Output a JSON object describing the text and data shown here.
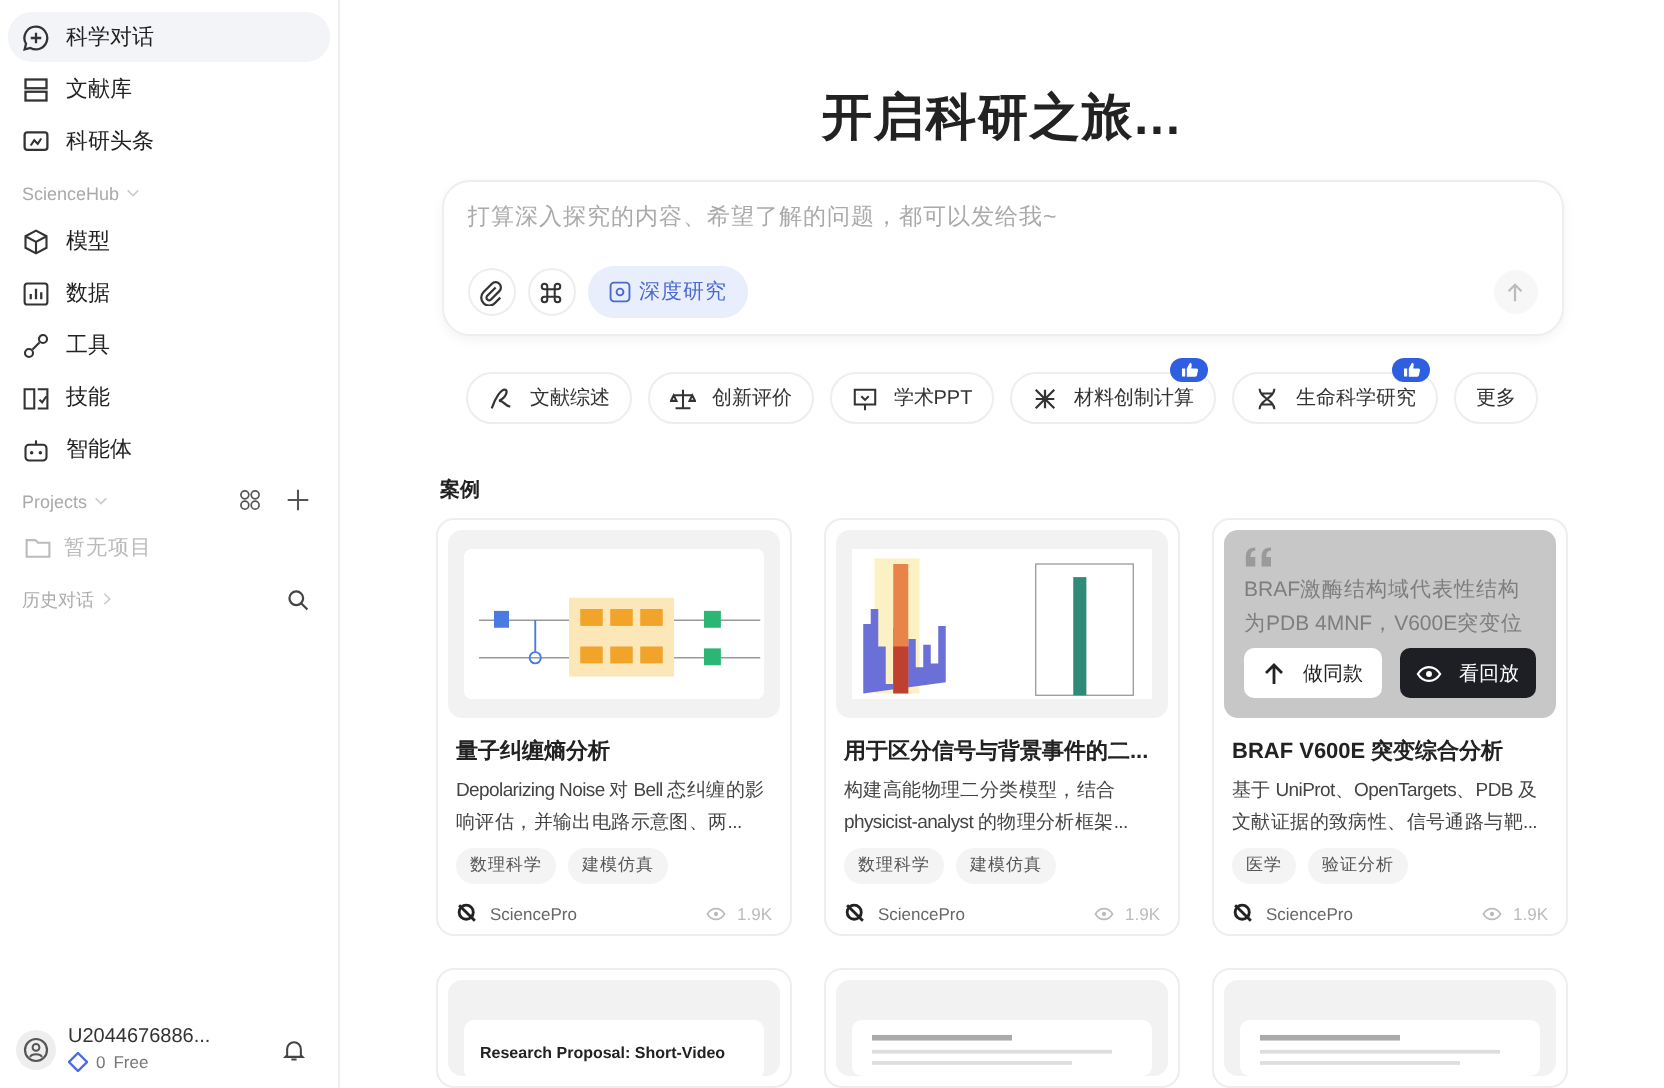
{
  "sidebar": {
    "main_items": [
      {
        "label": "科学对话",
        "selected": true
      },
      {
        "label": "文献库",
        "selected": false
      },
      {
        "label": "科研头条",
        "selected": false
      }
    ],
    "hub_section": {
      "label": "ScienceHub"
    },
    "hub_items": [
      {
        "label": "模型",
        "selected": false
      },
      {
        "label": "数据",
        "selected": false
      },
      {
        "label": "工具",
        "selected": false
      },
      {
        "label": "技能",
        "selected": false
      },
      {
        "label": "智能体",
        "selected": false
      }
    ],
    "projects": {
      "label": "Projects",
      "empty_text": "暂无项目"
    },
    "history": {
      "label": "历史对话"
    },
    "user": {
      "name": "U2044676886...",
      "points": "0",
      "plan": "Free"
    }
  },
  "main": {
    "title": "开启科研之旅...",
    "composer": {
      "placeholder": "打算深入探究的内容、希望了解的问题，都可以发给我~",
      "deep_research": {
        "label": "深度研究",
        "on": true
      }
    },
    "quick_actions": [
      {
        "label": "文献综述",
        "liked": false
      },
      {
        "label": "创新评价",
        "liked": false
      },
      {
        "label": "学术PPT",
        "liked": false
      },
      {
        "label": "材料创制计算",
        "liked": true
      },
      {
        "label": "生命科学研究",
        "liked": true
      },
      {
        "label": "更多",
        "liked": false
      }
    ],
    "cases_heading": "案例",
    "cases": [
      {
        "title": "量子纠缠熵分析",
        "description": "Depolarizing Noise 对 Bell 态纠缠的影响评估，并输出电路示意图、两...",
        "tags": [
          "数理科学",
          "建模仿真"
        ],
        "author": "SciencePro",
        "views": "1.9K"
      },
      {
        "title": "用于区分信号与背景事件的二...",
        "description": "构建高能物理二分类模型，结合 physicist-analyst 的物理分析框架...",
        "tags": [
          "数理科学",
          "建模仿真"
        ],
        "author": "SciencePro",
        "views": "1.9K"
      },
      {
        "quote_lines": [
          "BRAF激酶结构域代表性结构",
          "为PDB 4MNF，V600E突变位"
        ],
        "actions": [
          "做同款",
          "看回放"
        ],
        "title": "BRAF V600E 突变综合分析",
        "description": "基于 UniProt、OpenTargets、PDB 及文献证据的致病性、信号通路与靶...",
        "tags": [
          "医学",
          "验证分析"
        ],
        "author": "SciencePro",
        "views": "1.9K"
      }
    ],
    "more_cases": [
      {
        "doc_title": "Research Proposal: Short-Video"
      },
      {
        "kind": "picture"
      },
      {
        "kind": "picture"
      }
    ]
  }
}
